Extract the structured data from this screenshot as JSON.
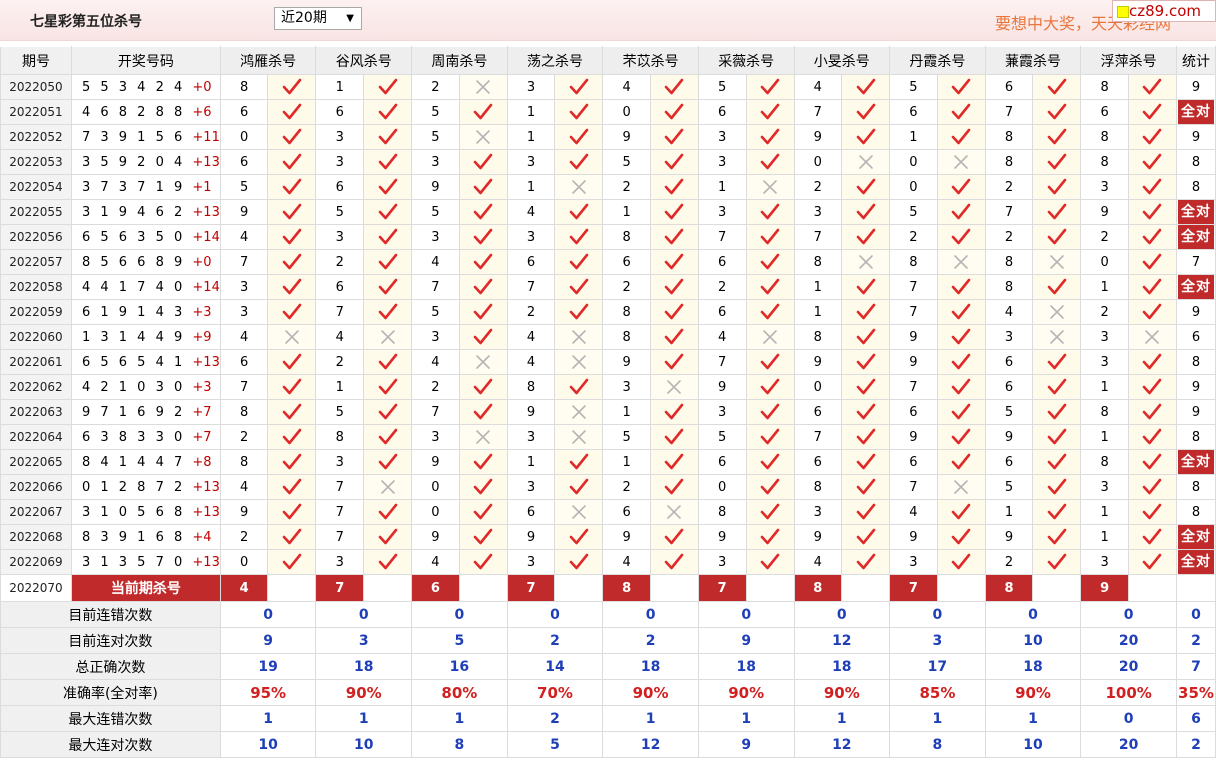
{
  "header": {
    "title": "七星彩第五位杀号",
    "range_select": "近20期",
    "slogan": "要想中大奖，天天彩经网",
    "logo_text": "cz89.com"
  },
  "columns": {
    "period": "期号",
    "numbers": "开奖号码",
    "experts": [
      "鸿雁杀号",
      "谷风杀号",
      "周南杀号",
      "荡之杀号",
      "芣苡杀号",
      "采薇杀号",
      "小旻杀号",
      "丹霞杀号",
      "蒹霞杀号",
      "浮萍杀号"
    ],
    "total": "统计"
  },
  "rows": [
    {
      "period": "2022050",
      "nums": "5 5 3 4 2 4",
      "sum": "+0",
      "kills": [
        8,
        1,
        2,
        3,
        4,
        5,
        4,
        5,
        6,
        8
      ],
      "ok": [
        1,
        1,
        0,
        1,
        1,
        1,
        1,
        1,
        1,
        1
      ],
      "total": "9"
    },
    {
      "period": "2022051",
      "nums": "4 6 8 2 8 8",
      "sum": "+6",
      "kills": [
        6,
        6,
        5,
        1,
        0,
        6,
        7,
        6,
        7,
        6
      ],
      "ok": [
        1,
        1,
        1,
        1,
        1,
        1,
        1,
        1,
        1,
        1
      ],
      "total": "全对"
    },
    {
      "period": "2022052",
      "nums": "7 3 9 1 5 6",
      "sum": "+11",
      "kills": [
        0,
        3,
        5,
        1,
        9,
        3,
        9,
        1,
        8,
        8
      ],
      "ok": [
        1,
        1,
        0,
        1,
        1,
        1,
        1,
        1,
        1,
        1
      ],
      "total": "9"
    },
    {
      "period": "2022053",
      "nums": "3 5 9 2 0 4",
      "sum": "+13",
      "kills": [
        6,
        3,
        3,
        3,
        5,
        3,
        0,
        0,
        8,
        8
      ],
      "ok": [
        1,
        1,
        1,
        1,
        1,
        1,
        0,
        0,
        1,
        1
      ],
      "total": "8"
    },
    {
      "period": "2022054",
      "nums": "3 7 3 7 1 9",
      "sum": "+1",
      "kills": [
        5,
        6,
        9,
        1,
        2,
        1,
        2,
        0,
        2,
        3
      ],
      "ok": [
        1,
        1,
        1,
        0,
        1,
        0,
        1,
        1,
        1,
        1
      ],
      "total": "8"
    },
    {
      "period": "2022055",
      "nums": "3 1 9 4 6 2",
      "sum": "+13",
      "kills": [
        9,
        5,
        5,
        4,
        1,
        3,
        3,
        5,
        7,
        9
      ],
      "ok": [
        1,
        1,
        1,
        1,
        1,
        1,
        1,
        1,
        1,
        1
      ],
      "total": "全对"
    },
    {
      "period": "2022056",
      "nums": "6 5 6 3 5 0",
      "sum": "+14",
      "kills": [
        4,
        3,
        3,
        3,
        8,
        7,
        7,
        2,
        2,
        2
      ],
      "ok": [
        1,
        1,
        1,
        1,
        1,
        1,
        1,
        1,
        1,
        1
      ],
      "total": "全对"
    },
    {
      "period": "2022057",
      "nums": "8 5 6 6 8 9",
      "sum": "+0",
      "kills": [
        7,
        2,
        4,
        6,
        6,
        6,
        8,
        8,
        8,
        0
      ],
      "ok": [
        1,
        1,
        1,
        1,
        1,
        1,
        0,
        0,
        0,
        1
      ],
      "total": "7"
    },
    {
      "period": "2022058",
      "nums": "4 4 1 7 4 0",
      "sum": "+14",
      "kills": [
        3,
        6,
        7,
        7,
        2,
        2,
        1,
        7,
        8,
        1
      ],
      "ok": [
        1,
        1,
        1,
        1,
        1,
        1,
        1,
        1,
        1,
        1
      ],
      "total": "全对"
    },
    {
      "period": "2022059",
      "nums": "6 1 9 1 4 3",
      "sum": "+3",
      "kills": [
        3,
        7,
        5,
        2,
        8,
        6,
        1,
        7,
        4,
        2
      ],
      "ok": [
        1,
        1,
        1,
        1,
        1,
        1,
        1,
        1,
        0,
        1
      ],
      "total": "9"
    },
    {
      "period": "2022060",
      "nums": "1 3 1 4 4 9",
      "sum": "+9",
      "kills": [
        4,
        4,
        3,
        4,
        8,
        4,
        8,
        9,
        3,
        3
      ],
      "ok": [
        0,
        0,
        1,
        0,
        1,
        0,
        1,
        1,
        0,
        0
      ],
      "total": "6"
    },
    {
      "period": "2022061",
      "nums": "6 5 6 5 4 1",
      "sum": "+13",
      "kills": [
        6,
        2,
        4,
        4,
        9,
        7,
        9,
        9,
        6,
        3
      ],
      "ok": [
        1,
        1,
        0,
        0,
        1,
        1,
        1,
        1,
        1,
        1
      ],
      "total": "8"
    },
    {
      "period": "2022062",
      "nums": "4 2 1 0 3 0",
      "sum": "+3",
      "kills": [
        7,
        1,
        2,
        8,
        3,
        9,
        0,
        7,
        6,
        1
      ],
      "ok": [
        1,
        1,
        1,
        1,
        0,
        1,
        1,
        1,
        1,
        1
      ],
      "total": "9"
    },
    {
      "period": "2022063",
      "nums": "9 7 1 6 9 2",
      "sum": "+7",
      "kills": [
        8,
        5,
        7,
        9,
        1,
        3,
        6,
        6,
        5,
        8
      ],
      "ok": [
        1,
        1,
        1,
        0,
        1,
        1,
        1,
        1,
        1,
        1
      ],
      "total": "9"
    },
    {
      "period": "2022064",
      "nums": "6 3 8 3 3 0",
      "sum": "+7",
      "kills": [
        2,
        8,
        3,
        3,
        5,
        5,
        7,
        9,
        9,
        1
      ],
      "ok": [
        1,
        1,
        0,
        0,
        1,
        1,
        1,
        1,
        1,
        1
      ],
      "total": "8"
    },
    {
      "period": "2022065",
      "nums": "8 4 1 4 4 7",
      "sum": "+8",
      "kills": [
        8,
        3,
        9,
        1,
        1,
        6,
        6,
        6,
        6,
        8
      ],
      "ok": [
        1,
        1,
        1,
        1,
        1,
        1,
        1,
        1,
        1,
        1
      ],
      "total": "全对"
    },
    {
      "period": "2022066",
      "nums": "0 1 2 8 7 2",
      "sum": "+13",
      "kills": [
        4,
        7,
        0,
        3,
        2,
        0,
        8,
        7,
        5,
        3
      ],
      "ok": [
        1,
        0,
        1,
        1,
        1,
        1,
        1,
        0,
        1,
        1
      ],
      "total": "8"
    },
    {
      "period": "2022067",
      "nums": "3 1 0 5 6 8",
      "sum": "+13",
      "kills": [
        9,
        7,
        0,
        6,
        6,
        8,
        3,
        4,
        1,
        1
      ],
      "ok": [
        1,
        1,
        1,
        0,
        0,
        1,
        1,
        1,
        1,
        1
      ],
      "total": "8"
    },
    {
      "period": "2022068",
      "nums": "8 3 9 1 6 8",
      "sum": "+4",
      "kills": [
        2,
        7,
        9,
        9,
        9,
        9,
        9,
        9,
        9,
        1
      ],
      "ok": [
        1,
        1,
        1,
        1,
        1,
        1,
        1,
        1,
        1,
        1
      ],
      "total": "全对"
    },
    {
      "period": "2022069",
      "nums": "3 1 3 5 7 0",
      "sum": "+13",
      "kills": [
        0,
        3,
        4,
        3,
        4,
        3,
        4,
        3,
        2,
        3
      ],
      "ok": [
        1,
        1,
        1,
        1,
        1,
        1,
        1,
        1,
        1,
        1
      ],
      "total": "全对"
    }
  ],
  "current": {
    "period": "2022070",
    "label": "当前期杀号",
    "kills": [
      4,
      7,
      6,
      7,
      8,
      7,
      8,
      7,
      8,
      9
    ]
  },
  "stats": [
    {
      "label": "目前连错次数",
      "values": [
        "0",
        "0",
        "0",
        "0",
        "0",
        "0",
        "0",
        "0",
        "0",
        "0",
        "0"
      ],
      "style": "blue"
    },
    {
      "label": "目前连对次数",
      "values": [
        "9",
        "3",
        "5",
        "2",
        "2",
        "9",
        "12",
        "3",
        "10",
        "20",
        "2"
      ],
      "style": "blue"
    },
    {
      "label": "总正确次数",
      "values": [
        "19",
        "18",
        "16",
        "14",
        "18",
        "18",
        "18",
        "17",
        "18",
        "20",
        "7"
      ],
      "style": "blue"
    },
    {
      "label": "准确率(全对率)",
      "values": [
        "95%",
        "90%",
        "80%",
        "70%",
        "90%",
        "90%",
        "90%",
        "85%",
        "90%",
        "100%",
        "35%"
      ],
      "style": "red"
    },
    {
      "label": "最大连错次数",
      "values": [
        "1",
        "1",
        "1",
        "2",
        "1",
        "1",
        "1",
        "1",
        "1",
        "0",
        "6"
      ],
      "style": "blue"
    },
    {
      "label": "最大连对次数",
      "values": [
        "10",
        "10",
        "8",
        "5",
        "12",
        "9",
        "12",
        "8",
        "10",
        "20",
        "2"
      ],
      "style": "blue"
    }
  ],
  "icons": {
    "correct": "check-icon",
    "wrong": "cross-icon"
  },
  "colors": {
    "correct": "#e02a2a",
    "wrong": "#b5b5b5",
    "accent": "#c02a2a",
    "stat_blue": "#1f3fb8"
  }
}
